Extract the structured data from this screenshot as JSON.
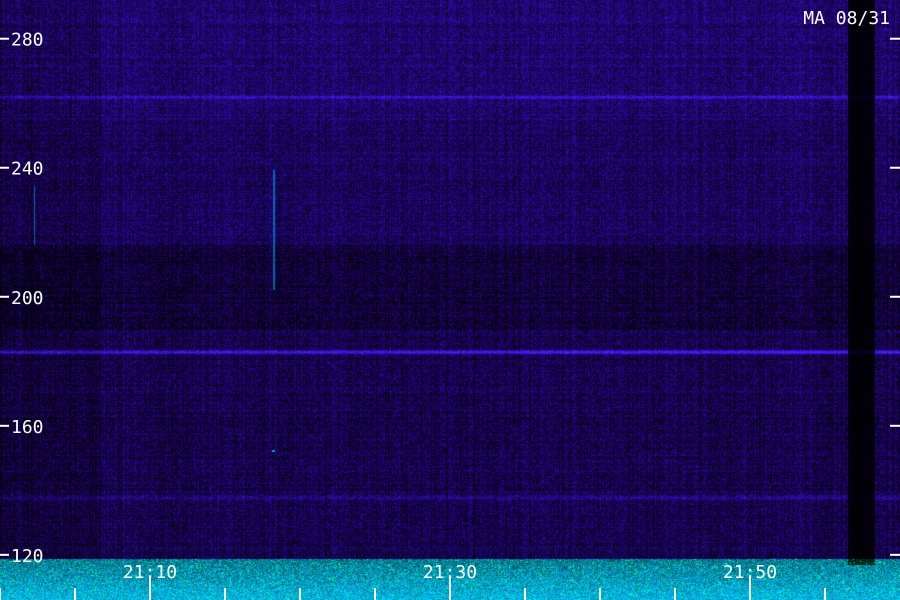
{
  "chart_data": {
    "type": "heatmap",
    "title": "",
    "station_date": "MA 08/31",
    "xlabel": "",
    "ylabel": "",
    "x_tick_labels": [
      "21:10",
      "21:30",
      "21:50"
    ],
    "x_tick_minutes": [
      10,
      30,
      50
    ],
    "xlim_minutes": [
      0,
      59
    ],
    "y_tick_labels": [
      "280",
      "240",
      "200",
      "160",
      "120"
    ],
    "y_ticks": [
      280,
      240,
      200,
      160,
      120
    ],
    "ylim": [
      106,
      292
    ],
    "colormap": [
      "#000000",
      "#2a0a6e",
      "#4a1aa8",
      "#2f3cff",
      "#00c8ff",
      "#3cff9a"
    ],
    "features": [
      {
        "kind": "horizontal_band",
        "value": 183,
        "intensity": 0.85,
        "color": "#2f3cff"
      },
      {
        "kind": "horizontal_band",
        "value": 262,
        "intensity": 0.45,
        "color": "#4a4aff"
      },
      {
        "kind": "horizontal_band",
        "value": 138,
        "intensity": 0.35,
        "color": "#3f5bff"
      },
      {
        "kind": "dark_gap",
        "from_minute": 56.5,
        "to_minute": 58.3
      },
      {
        "kind": "bright_noise_floor",
        "below": 119,
        "color": "#00c8ff"
      }
    ]
  }
}
